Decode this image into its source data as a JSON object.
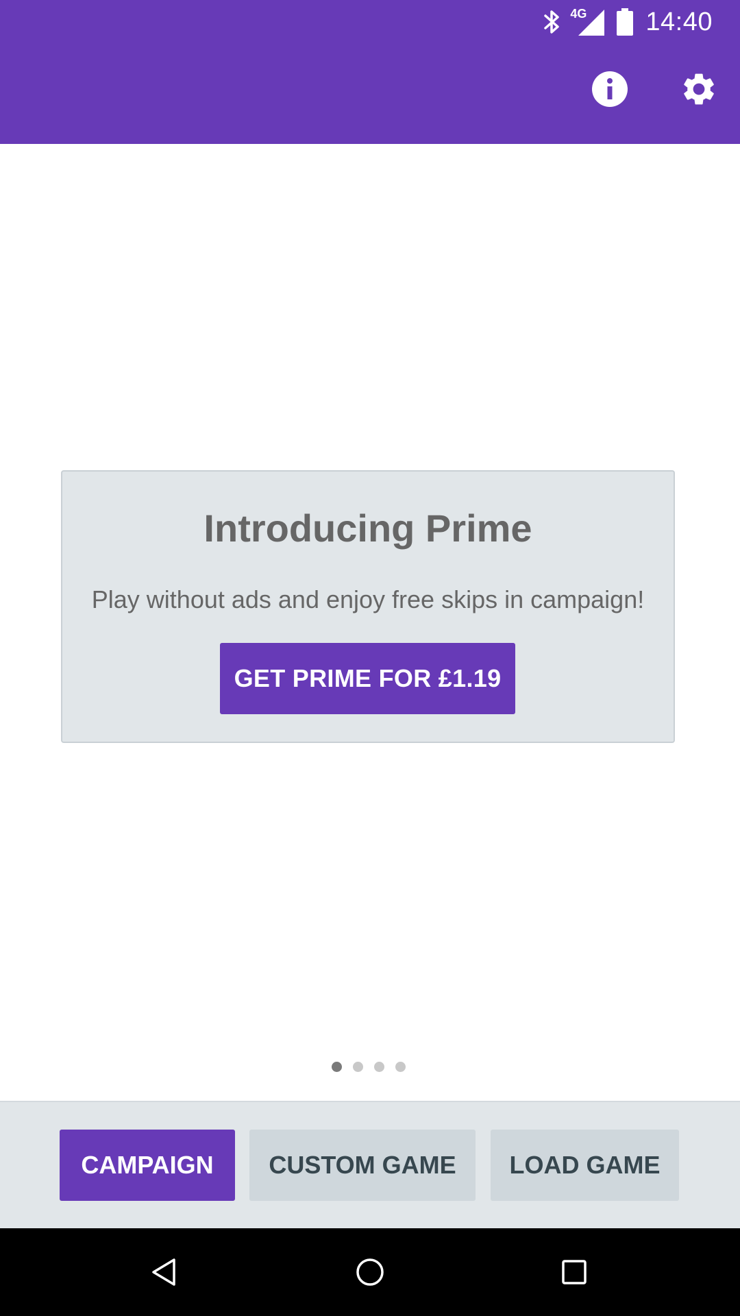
{
  "status_bar": {
    "network": "4G",
    "time": "14:40",
    "icons": [
      "bluetooth-icon",
      "signal-icon",
      "battery-icon"
    ]
  },
  "toolbar": {
    "icons": [
      "info-icon",
      "settings-icon"
    ]
  },
  "promo": {
    "title": "Introducing Prime",
    "description": "Play without ads and enjoy free skips in campaign!",
    "button_label": "GET PRIME FOR £1.19"
  },
  "pager": {
    "page_count": 4,
    "active_page": 1
  },
  "bottom_bar": {
    "campaign_label": "CAMPAIGN",
    "custom_game_label": "CUSTOM GAME",
    "load_game_label": "LOAD GAME"
  },
  "nav_bar": {
    "icons": [
      "back-icon",
      "home-icon",
      "recents-icon"
    ]
  },
  "colors": {
    "primary": "#673AB7",
    "card_background": "#E1E6E9",
    "secondary_button": "#CFD7DC",
    "secondary_text": "#37474F"
  }
}
